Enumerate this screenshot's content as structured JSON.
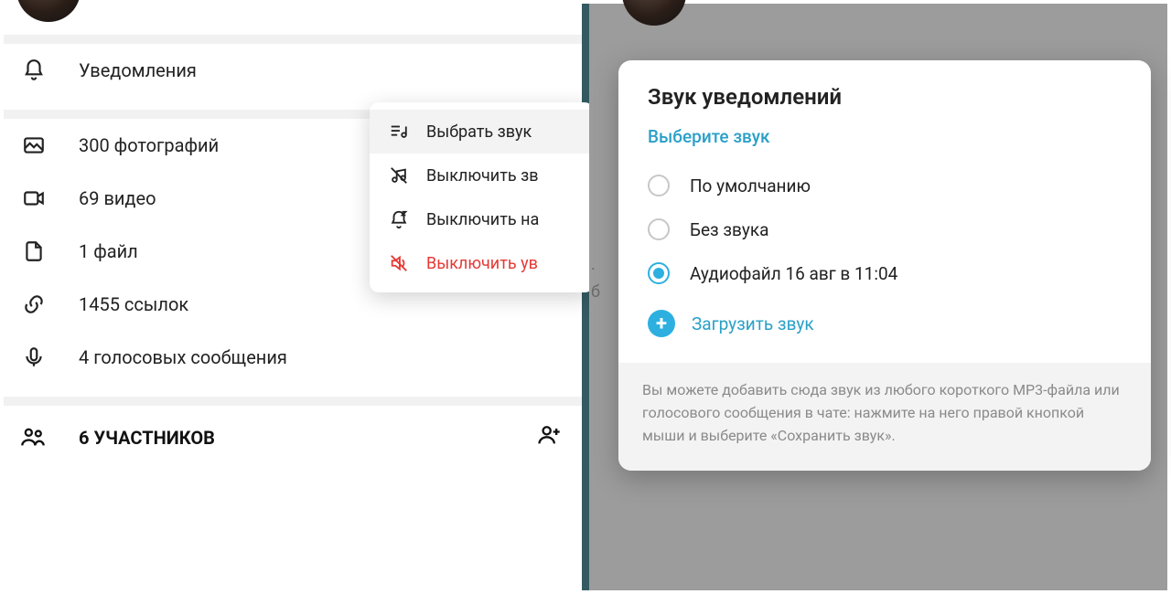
{
  "left": {
    "notifications_label": "Уведомления",
    "media": {
      "photos": "300 фотографий",
      "videos": "69 видео",
      "files": "1 файл",
      "links": "1455 ссылок",
      "voice": "4 голосовых сообщения"
    },
    "members": "6 УЧАСТНИКОВ"
  },
  "context_menu": {
    "select_sound": "Выбрать звук",
    "mute_sound": "Выключить зв",
    "mute_for": "Выключить на",
    "disable_notifications": "Выключить ув"
  },
  "modal": {
    "title": "Звук уведомлений",
    "subtitle": "Выберите звук",
    "option_default": "По умолчанию",
    "option_silent": "Без звука",
    "option_audio": "Аудиофайл 16 авг в 11:04",
    "upload": "Загрузить звук",
    "footer": "Вы можете добавить сюда звук из любого короткого MP3-файла или голосового сообщения в чате: нажмите на него правой кнопкой мыши и выберите «Сохранить звук»."
  },
  "edge_chars": {
    "a": ".",
    "b": "б"
  }
}
